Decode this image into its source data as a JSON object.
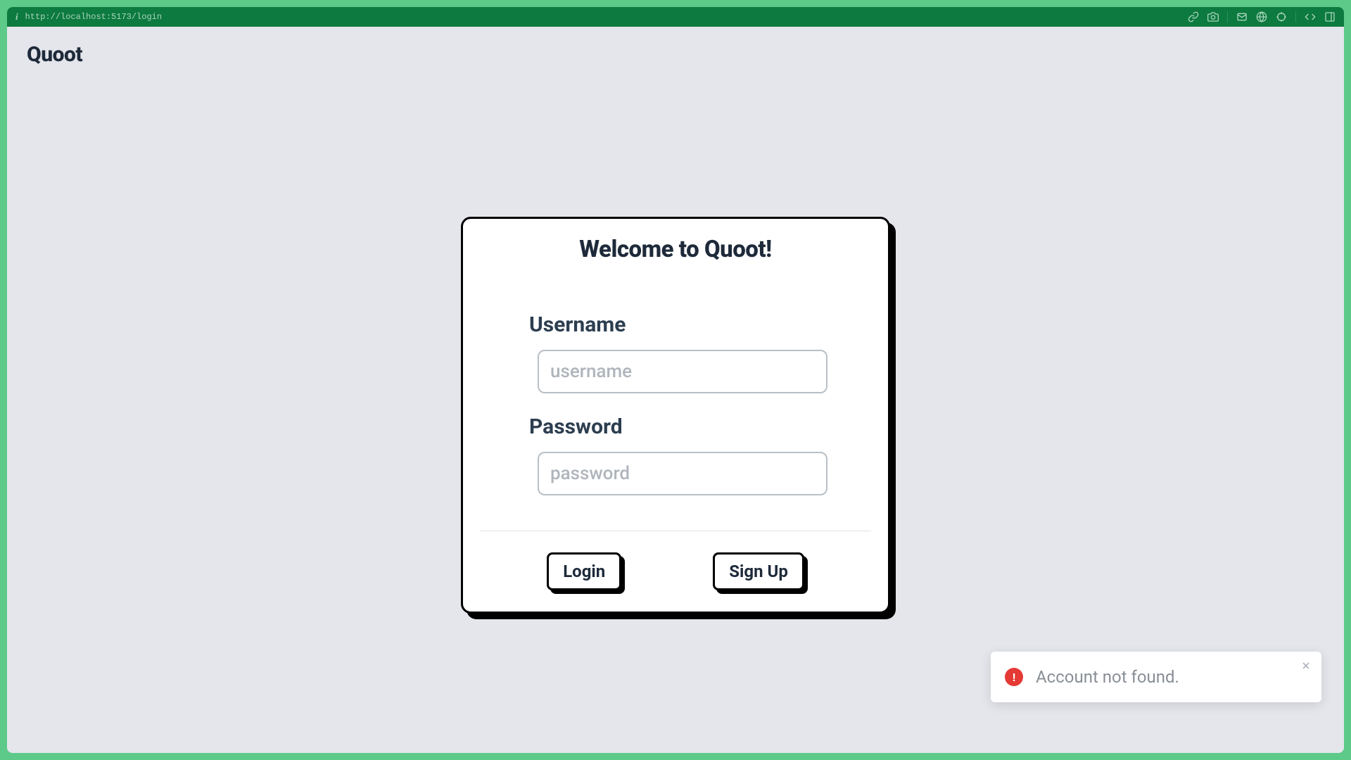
{
  "browser": {
    "url": "http://localhost:5173/login"
  },
  "app": {
    "logo": "Quoot"
  },
  "login": {
    "title": "Welcome to Quoot!",
    "username_label": "Username",
    "username_placeholder": "username",
    "username_value": "",
    "password_label": "Password",
    "password_placeholder": "password",
    "password_value": "",
    "login_button": "Login",
    "signup_button": "Sign Up"
  },
  "toast": {
    "message": "Account not found.",
    "type": "error"
  }
}
